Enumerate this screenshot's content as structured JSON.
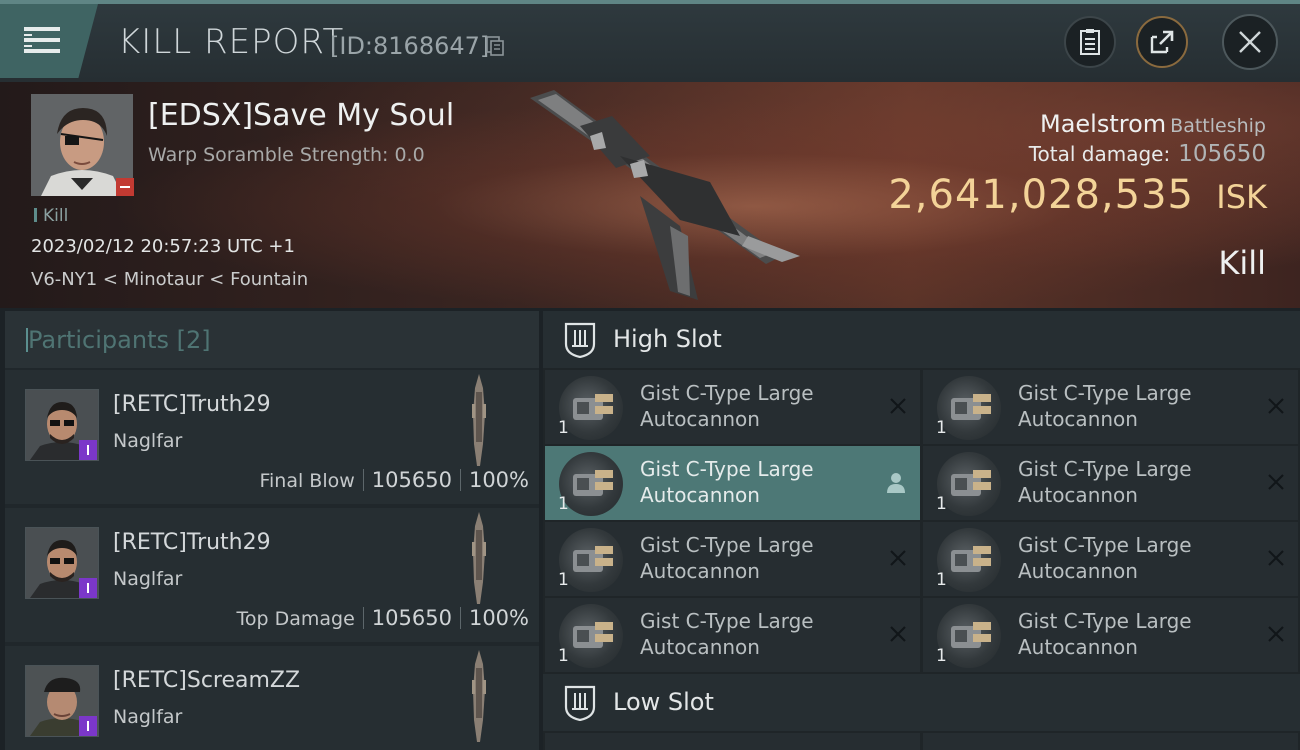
{
  "header": {
    "title": "KILL REPORT",
    "kill_id": "[ID:8168647]"
  },
  "victim": {
    "name": "[EDSX]Save My Soul",
    "warp_scramble": "Warp Soramble Strength: 0.0",
    "tag": "Kill",
    "datetime": "2023/02/12 20:57:23 UTC +1",
    "location": "V6-NY1 < Minotaur < Fountain",
    "ship": "Maelstrom",
    "ship_class": "Battleship",
    "total_damage_label": "Total damage:",
    "total_damage": "105650",
    "isk_value": "2,641,028,535",
    "isk_unit": "ISK",
    "result_label": "Kill"
  },
  "participants": {
    "title": "Participants [2]",
    "items": [
      {
        "name": "[RETC]Truth29",
        "ship": "Naglfar",
        "label": "Final Blow",
        "damage": "105650",
        "percent": "100%"
      },
      {
        "name": "[RETC]Truth29",
        "ship": "Naglfar",
        "label": "Top Damage",
        "damage": "105650",
        "percent": "100%"
      },
      {
        "name": "[RETC]ScreamZZ",
        "ship": "Naglfar"
      }
    ]
  },
  "fitting": {
    "high_slot": {
      "title": "High Slot",
      "modules": [
        {
          "line1": "Gist C-Type Large",
          "line2": "Autocannon",
          "qty": "1"
        },
        {
          "line1": "Gist C-Type Large",
          "line2": "Autocannon",
          "qty": "1"
        },
        {
          "line1": "Gist C-Type Large",
          "line2": "Autocannon",
          "qty": "1"
        },
        {
          "line1": "Gist C-Type Large",
          "line2": "Autocannon",
          "qty": "1"
        },
        {
          "line1": "Gist C-Type Large",
          "line2": "Autocannon",
          "qty": "1"
        },
        {
          "line1": "Gist C-Type Large",
          "line2": "Autocannon",
          "qty": "1"
        },
        {
          "line1": "Gist C-Type Large",
          "line2": "Autocannon",
          "qty": "1"
        },
        {
          "line1": "Gist C-Type Large",
          "line2": "Autocannon",
          "qty": "1"
        }
      ]
    },
    "low_slot": {
      "title": "Low Slot"
    }
  },
  "colors": {
    "accent_teal": "#4d7876",
    "isk_gold": "#f3d398",
    "badge_purple": "#7b37c9",
    "badge_red": "#c23a32"
  },
  "icons": [
    "menu-icon",
    "copy-icon",
    "report-icon",
    "share-icon",
    "close-icon",
    "turret-icon",
    "remove-icon",
    "person-icon",
    "slot-icon"
  ]
}
